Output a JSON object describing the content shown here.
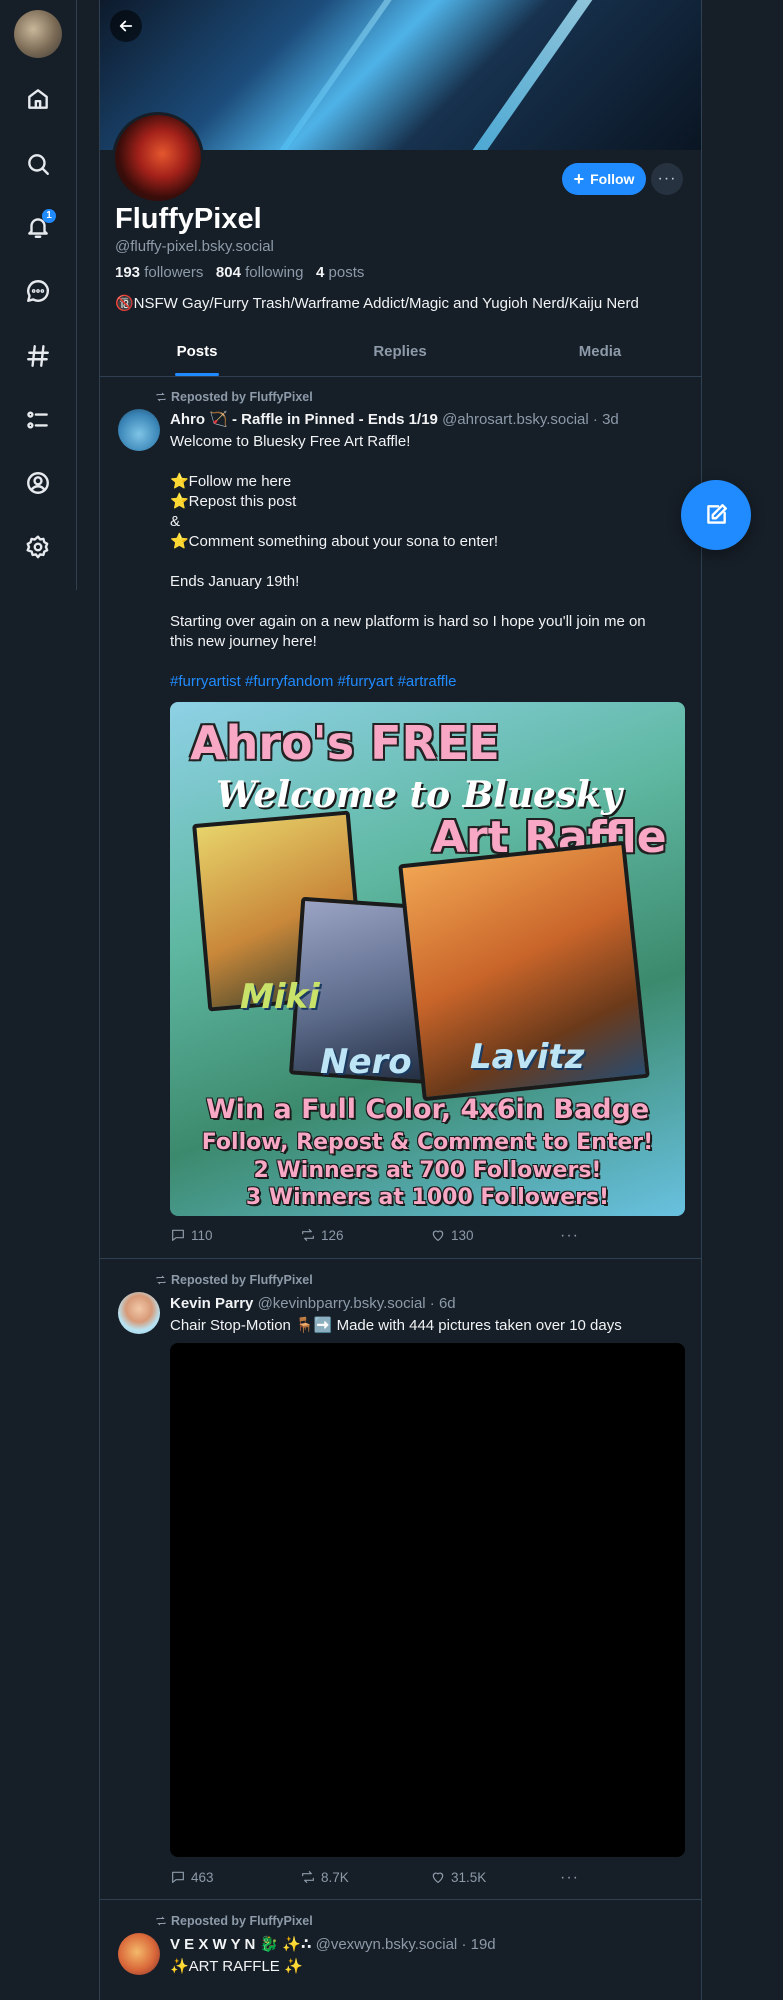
{
  "profile": {
    "display_name": "FluffyPixel",
    "handle": "@fluffy-pixel.bsky.social",
    "followers_count": "193",
    "followers_label": "followers",
    "following_count": "804",
    "following_label": "following",
    "posts_count": "4",
    "posts_label": "posts",
    "bio": "🔞NSFW Gay/Furry Trash/Warframe Addict/Magic and Yugioh Nerd/Kaiju Nerd",
    "follow_label": "Follow",
    "more_label": "···"
  },
  "nav": {
    "notifications_badge": "1",
    "items": [
      "home-icon",
      "search-icon",
      "bell-icon",
      "chat-icon",
      "hashtag-icon",
      "list-icon",
      "profile-icon",
      "settings-icon"
    ]
  },
  "tabs": [
    {
      "label": "Posts",
      "active": true
    },
    {
      "label": "Replies",
      "active": false
    },
    {
      "label": "Media",
      "active": false
    }
  ],
  "posts": [
    {
      "repost_label": "Reposted by FluffyPixel",
      "author": "Ahro 🏹 - Raffle in Pinned - Ends 1/19",
      "handle": "@ahrosart.bsky.social",
      "time": "· 3d",
      "text_lines": [
        "Welcome to Bluesky Free Art Raffle!",
        "⭐Follow me here",
        "⭐Repost this post",
        "&",
        "⭐Comment something about your sona to enter!",
        "Ends January 19th!",
        "Starting over again on a new platform is hard so I hope you'll join me on",
        "this new journey here!"
      ],
      "hashtags": "#furryartist #furryfandom #furryart #artraffle",
      "image": {
        "title1": "Ahro's FREE",
        "title2": "Welcome to Bluesky",
        "title3": "Art Raffle",
        "label1": "Miki",
        "label2": "Nero",
        "label3": "Lavitz",
        "line1": "Win a Full Color, 4x6in Badge",
        "line2": "Follow, Repost & Comment to Enter!",
        "line3": "2 Winners at 700 Followers!",
        "line4": "3 Winners at 1000 Followers!"
      },
      "replies": "110",
      "reposts": "126",
      "likes": "130"
    },
    {
      "repost_label": "Reposted by FluffyPixel",
      "author": "Kevin Parry",
      "handle": "@kevinbparry.bsky.social",
      "time": "· 6d",
      "text": "Chair Stop-Motion 🪑➡️ Made with 444 pictures taken over 10 days",
      "replies": "463",
      "reposts": "8.7K",
      "likes": "31.5K"
    },
    {
      "repost_label": "Reposted by FluffyPixel",
      "author": "V E X W Y N 🐉 ✨∴",
      "handle": "@vexwyn.bsky.social",
      "time": "· 19d",
      "text": "✨ART RAFFLE ✨"
    }
  ],
  "colors": {
    "accent": "#208bfe",
    "background": "#161e27",
    "border": "#2e4052",
    "muted": "#8c9aa9"
  }
}
